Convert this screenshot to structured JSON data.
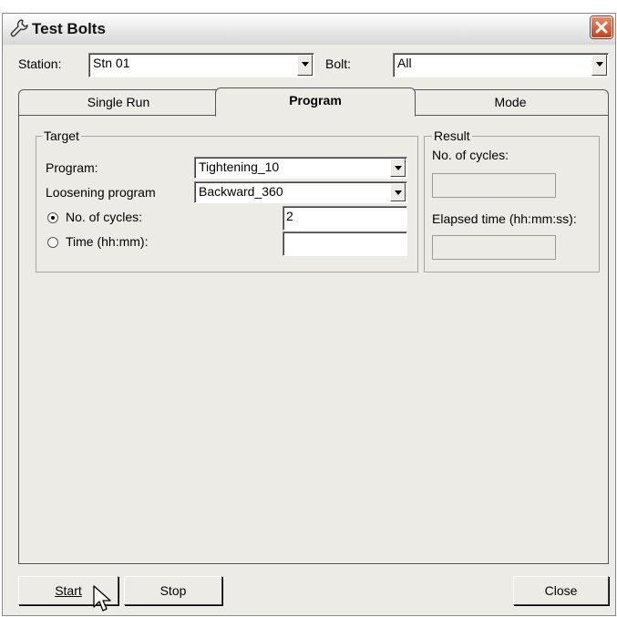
{
  "window": {
    "title": "Test Bolts"
  },
  "station": {
    "label": "Station:",
    "value": "Stn 01"
  },
  "bolt": {
    "label": "Bolt:",
    "value": "All"
  },
  "tabs": [
    {
      "label": "Single Run",
      "active": false
    },
    {
      "label": "Program",
      "active": true
    },
    {
      "label": "Mode",
      "active": false
    }
  ],
  "target": {
    "title": "Target",
    "program_label": "Program:",
    "program_value": "Tightening_10",
    "loosening_label": "Loosening program",
    "loosening_value": "Backward_360",
    "cycles_label": "No. of cycles:",
    "cycles_value": "2",
    "cycles_selected": true,
    "time_label": "Time (hh:mm):",
    "time_value": "",
    "time_selected": false
  },
  "result": {
    "title": "Result",
    "cycles_label": "No. of cycles:",
    "elapsed_label": "Elapsed time (hh:mm:ss):"
  },
  "buttons": {
    "start": "Start",
    "stop": "Stop",
    "close": "Close"
  },
  "icons": {
    "title": "wrench-icon",
    "close": "close-icon",
    "cursor": "mouse-pointer-icon"
  }
}
